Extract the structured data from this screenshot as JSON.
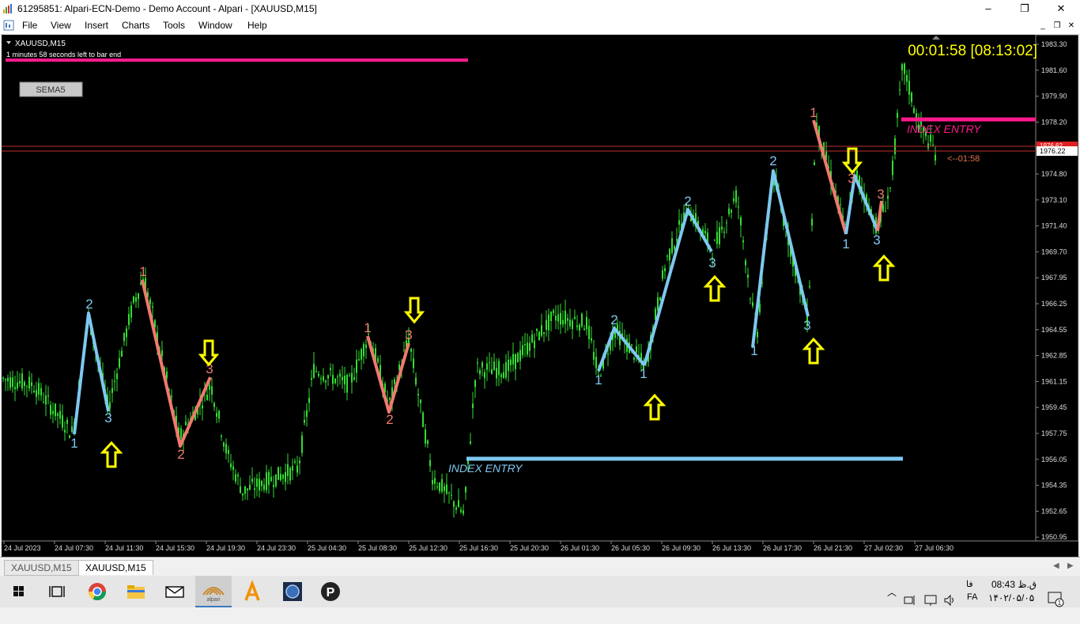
{
  "window": {
    "title": "61295851: Alpari-ECN-Demo - Demo Account - Alpari - [XAUUSD,M15]",
    "minimize": "–",
    "maximize": "❐",
    "close": "✕"
  },
  "menu": [
    "File",
    "View",
    "Insert",
    "Charts",
    "Tools",
    "Window",
    "Help"
  ],
  "mdi": {
    "minimize": "_",
    "restore": "❐",
    "close": "✕"
  },
  "chart": {
    "symbol_label": "XAUUSD,M15",
    "countdown_text": "1 minutes 58 seconds left to bar end",
    "timer": "00:01:58 [08:13:02]",
    "sema_button": "SEMA5",
    "bid_label": "1976.22",
    "ask_label": "1976.62",
    "bar_timer_label": "<--01:58",
    "colors": {
      "background": "#000000",
      "candles": "#33dd33",
      "zigzag_blue": "#7ec8f0",
      "zigzag_red": "#f07a6e",
      "arrow": "#ffff00",
      "magenta": "#ff1a8c",
      "timer": "#ffff00"
    },
    "price_axis": [
      "1983.30",
      "1981.60",
      "1979.90",
      "1978.20",
      "1976.50",
      "1974.80",
      "1973.10",
      "1971.40",
      "1969.70",
      "1967.95",
      "1966.25",
      "1964.55",
      "1962.85",
      "1961.15",
      "1959.45",
      "1957.75",
      "1956.05",
      "1954.35",
      "1952.65",
      "1950.95"
    ],
    "time_axis": [
      "24 Jul 2023",
      "24 Jul 07:30",
      "24 Jul 11:30",
      "24 Jul 15:30",
      "24 Jul 19:30",
      "24 Jul 23:30",
      "25 Jul 04:30",
      "25 Jul 08:30",
      "25 Jul 12:30",
      "25 Jul 16:30",
      "25 Jul 20:30",
      "26 Jul 01:30",
      "26 Jul 05:30",
      "26 Jul 09:30",
      "26 Jul 13:30",
      "26 Jul 17:30",
      "26 Jul 21:30",
      "27 Jul 02:30",
      "27 Jul 06:30"
    ],
    "annotations": {
      "index_entry_low": "INDEX ENTRY",
      "index_entry_high": "INDEX ENTRY"
    },
    "zigzag_labels": [
      {
        "text": "1",
        "color": "blue"
      },
      {
        "text": "2",
        "color": "blue"
      },
      {
        "text": "3",
        "color": "blue"
      },
      {
        "text": "1",
        "color": "red"
      },
      {
        "text": "2",
        "color": "red"
      },
      {
        "text": "3",
        "color": "red"
      },
      {
        "text": "1",
        "color": "red"
      },
      {
        "text": "2",
        "color": "red"
      },
      {
        "text": "3",
        "color": "red"
      },
      {
        "text": "1",
        "color": "blue"
      },
      {
        "text": "2",
        "color": "blue"
      },
      {
        "text": "1",
        "color": "blue"
      },
      {
        "text": "2",
        "color": "blue"
      },
      {
        "text": "3",
        "color": "blue"
      },
      {
        "text": "1",
        "color": "blue"
      },
      {
        "text": "2",
        "color": "blue"
      },
      {
        "text": "3",
        "color": "blue"
      },
      {
        "text": "1",
        "color": "red"
      },
      {
        "text": "3",
        "color": "red"
      },
      {
        "text": "1",
        "color": "blue"
      },
      {
        "text": "3",
        "color": "red"
      },
      {
        "text": "3",
        "color": "blue"
      }
    ]
  },
  "tabs": [
    "XAUUSD,M15",
    "XAUUSD,M15"
  ],
  "taskbar": {
    "time": "08:43 ق.ظ",
    "date": "۱۴۰۲/۰۵/۰۵",
    "lang_top": "فا",
    "lang_bottom": "FA",
    "notifications": "1"
  }
}
